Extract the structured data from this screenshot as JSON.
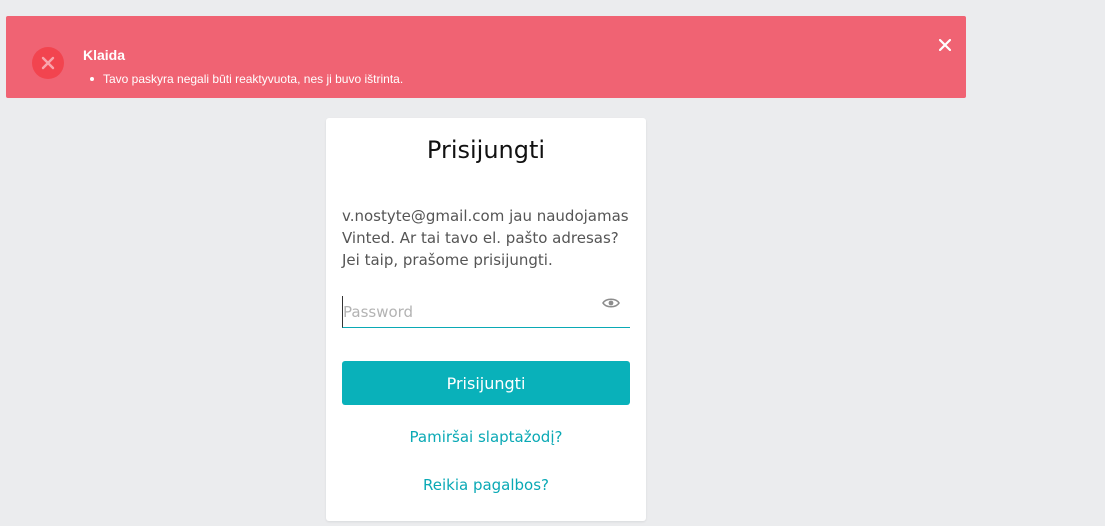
{
  "alert": {
    "title": "Klaida",
    "messages": [
      "Tavo paskyra negali būti reaktyvuota, nes ji buvo ištrinta."
    ],
    "icon": "error-x-icon",
    "close_icon": "close-icon",
    "color": "#f06373"
  },
  "login": {
    "title": "Prisijungti",
    "message": "v.nostyte@gmail.com jau naudojamas Vinted. Ar tai tavo el. pašto adresas? Jei taip, prašome prisijungti.",
    "password_placeholder": "Password",
    "password_value": "",
    "show_password_icon": "eye-icon",
    "submit_label": "Prisijungti",
    "forgot_link": "Pamiršai slaptažodį?",
    "help_link": "Reikia pagalbos?",
    "accent_color": "#09b1ba"
  }
}
